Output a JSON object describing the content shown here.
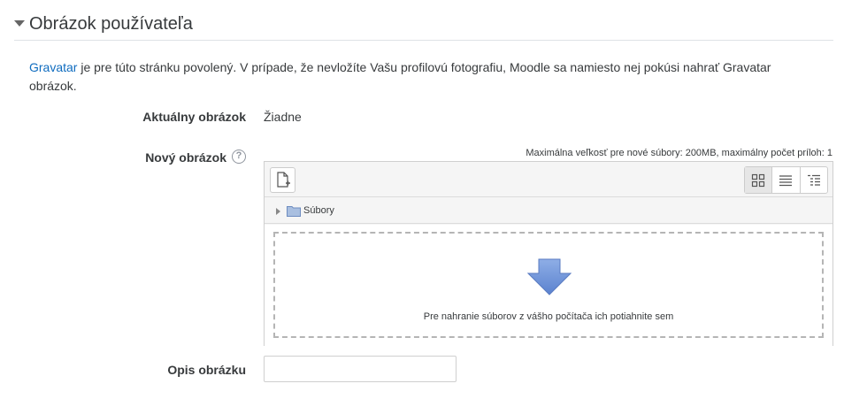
{
  "section": {
    "title": "Obrázok používateľa"
  },
  "intro": {
    "link_text": "Gravatar",
    "text": " je pre túto stránku povolený. V prípade, že nevložíte Vašu profilovú fotografiu, Moodle sa namiesto nej pokúsi nahrať Gravatar obrázok."
  },
  "current_picture": {
    "label": "Aktuálny obrázok",
    "value": "Žiadne"
  },
  "new_picture": {
    "label": "Nový obrázok",
    "help_icon": "question-circle-icon",
    "help_glyph": "?",
    "limits": "Maximálna veľkosť pre nové súbory: 200MB, maximálny počet príloh: 1"
  },
  "filemanager": {
    "add_icon": "add-file-icon",
    "views": [
      {
        "icon": "grid-view-icon",
        "active": true
      },
      {
        "icon": "list-view-icon",
        "active": false
      },
      {
        "icon": "tree-view-icon",
        "active": false
      }
    ],
    "path_label": "Súbory",
    "folder_icon": "folder-icon",
    "drop_icon": "down-arrow-icon",
    "drop_text": "Pre nahranie súborov z vášho počítača ich potiahnite sem"
  },
  "description": {
    "label": "Opis obrázku",
    "value": ""
  },
  "colors": {
    "link": "#0f6cbf",
    "drop_arrow": "#6a8fd6",
    "text": "#373a3c"
  }
}
